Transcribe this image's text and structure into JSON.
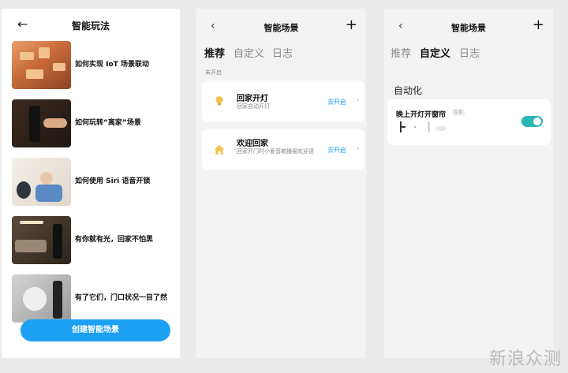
{
  "screen1": {
    "title": "智能玩法",
    "guides": [
      {
        "label": "如何实现 IoT 场景联动"
      },
      {
        "label": "如何玩转“离家”场景"
      },
      {
        "label": "如何使用 Siri 语音开锁"
      },
      {
        "label": "有你就有光，回家不怕黑"
      },
      {
        "label": "有了它们，门口状况一目了然"
      }
    ],
    "create_button": "创建智能场景"
  },
  "screen2": {
    "title": "智能场景",
    "tabs": [
      "推荐",
      "自定义",
      "日志"
    ],
    "active_tab": "推荐",
    "section_label": "未开启",
    "scenes": [
      {
        "name": "回家开灯",
        "desc": "回家自动开灯",
        "action": "去开启",
        "icon": "bulb-icon"
      },
      {
        "name": "欢迎回家",
        "desc": "回家开门时小爱音箱播报欢迎语",
        "action": "去开启",
        "icon": "home-icon"
      }
    ]
  },
  "screen3": {
    "title": "智能场景",
    "tabs": [
      "推荐",
      "自定义",
      "日志"
    ],
    "active_tab": "自定义",
    "section_label": "自动化",
    "automation": {
      "name": "晚上开灯开窗帘",
      "badge": "1.0",
      "enabled": true
    }
  },
  "watermark": "新浪众测",
  "colors": {
    "accent": "#1ba0f3",
    "toggle_on": "#2bb7b4",
    "page_bg": "#ebebeb"
  }
}
